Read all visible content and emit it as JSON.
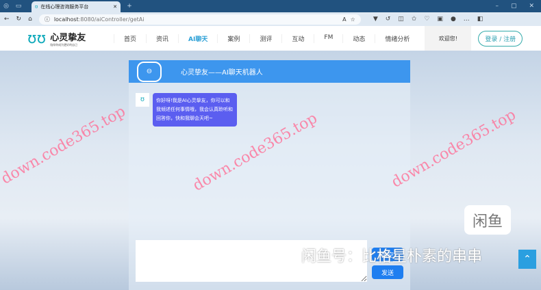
{
  "browser": {
    "tab_title": "在线心理咨询服务平台",
    "url_host": "localhost",
    "url_rest": ":8080/aiController/getAi"
  },
  "nav": {
    "brand": "心灵挚友",
    "slogan": "陪伴你成为更好的自己",
    "items": [
      "首页",
      "资讯",
      "AI聊天",
      "案例",
      "测评",
      "互动",
      "FM",
      "动态",
      "情绪分析"
    ],
    "welcome": "欢迎您!",
    "login": "登录 / 注册"
  },
  "chat": {
    "title": "心灵挚友——AI聊天机器人",
    "message": "你好呀!我是AI心灵挚友，你可以和我倾述任何事情哦，我会认真聆听和回答你，快和我聊会天吧~",
    "clear_label": "清空",
    "send_label": "发送",
    "input_value": ""
  },
  "watermarks": {
    "site": "down.code365.top",
    "xianyu_logo": "闲鱼",
    "xianyu_text": "闲鱼号：比格星朴素的串串"
  }
}
